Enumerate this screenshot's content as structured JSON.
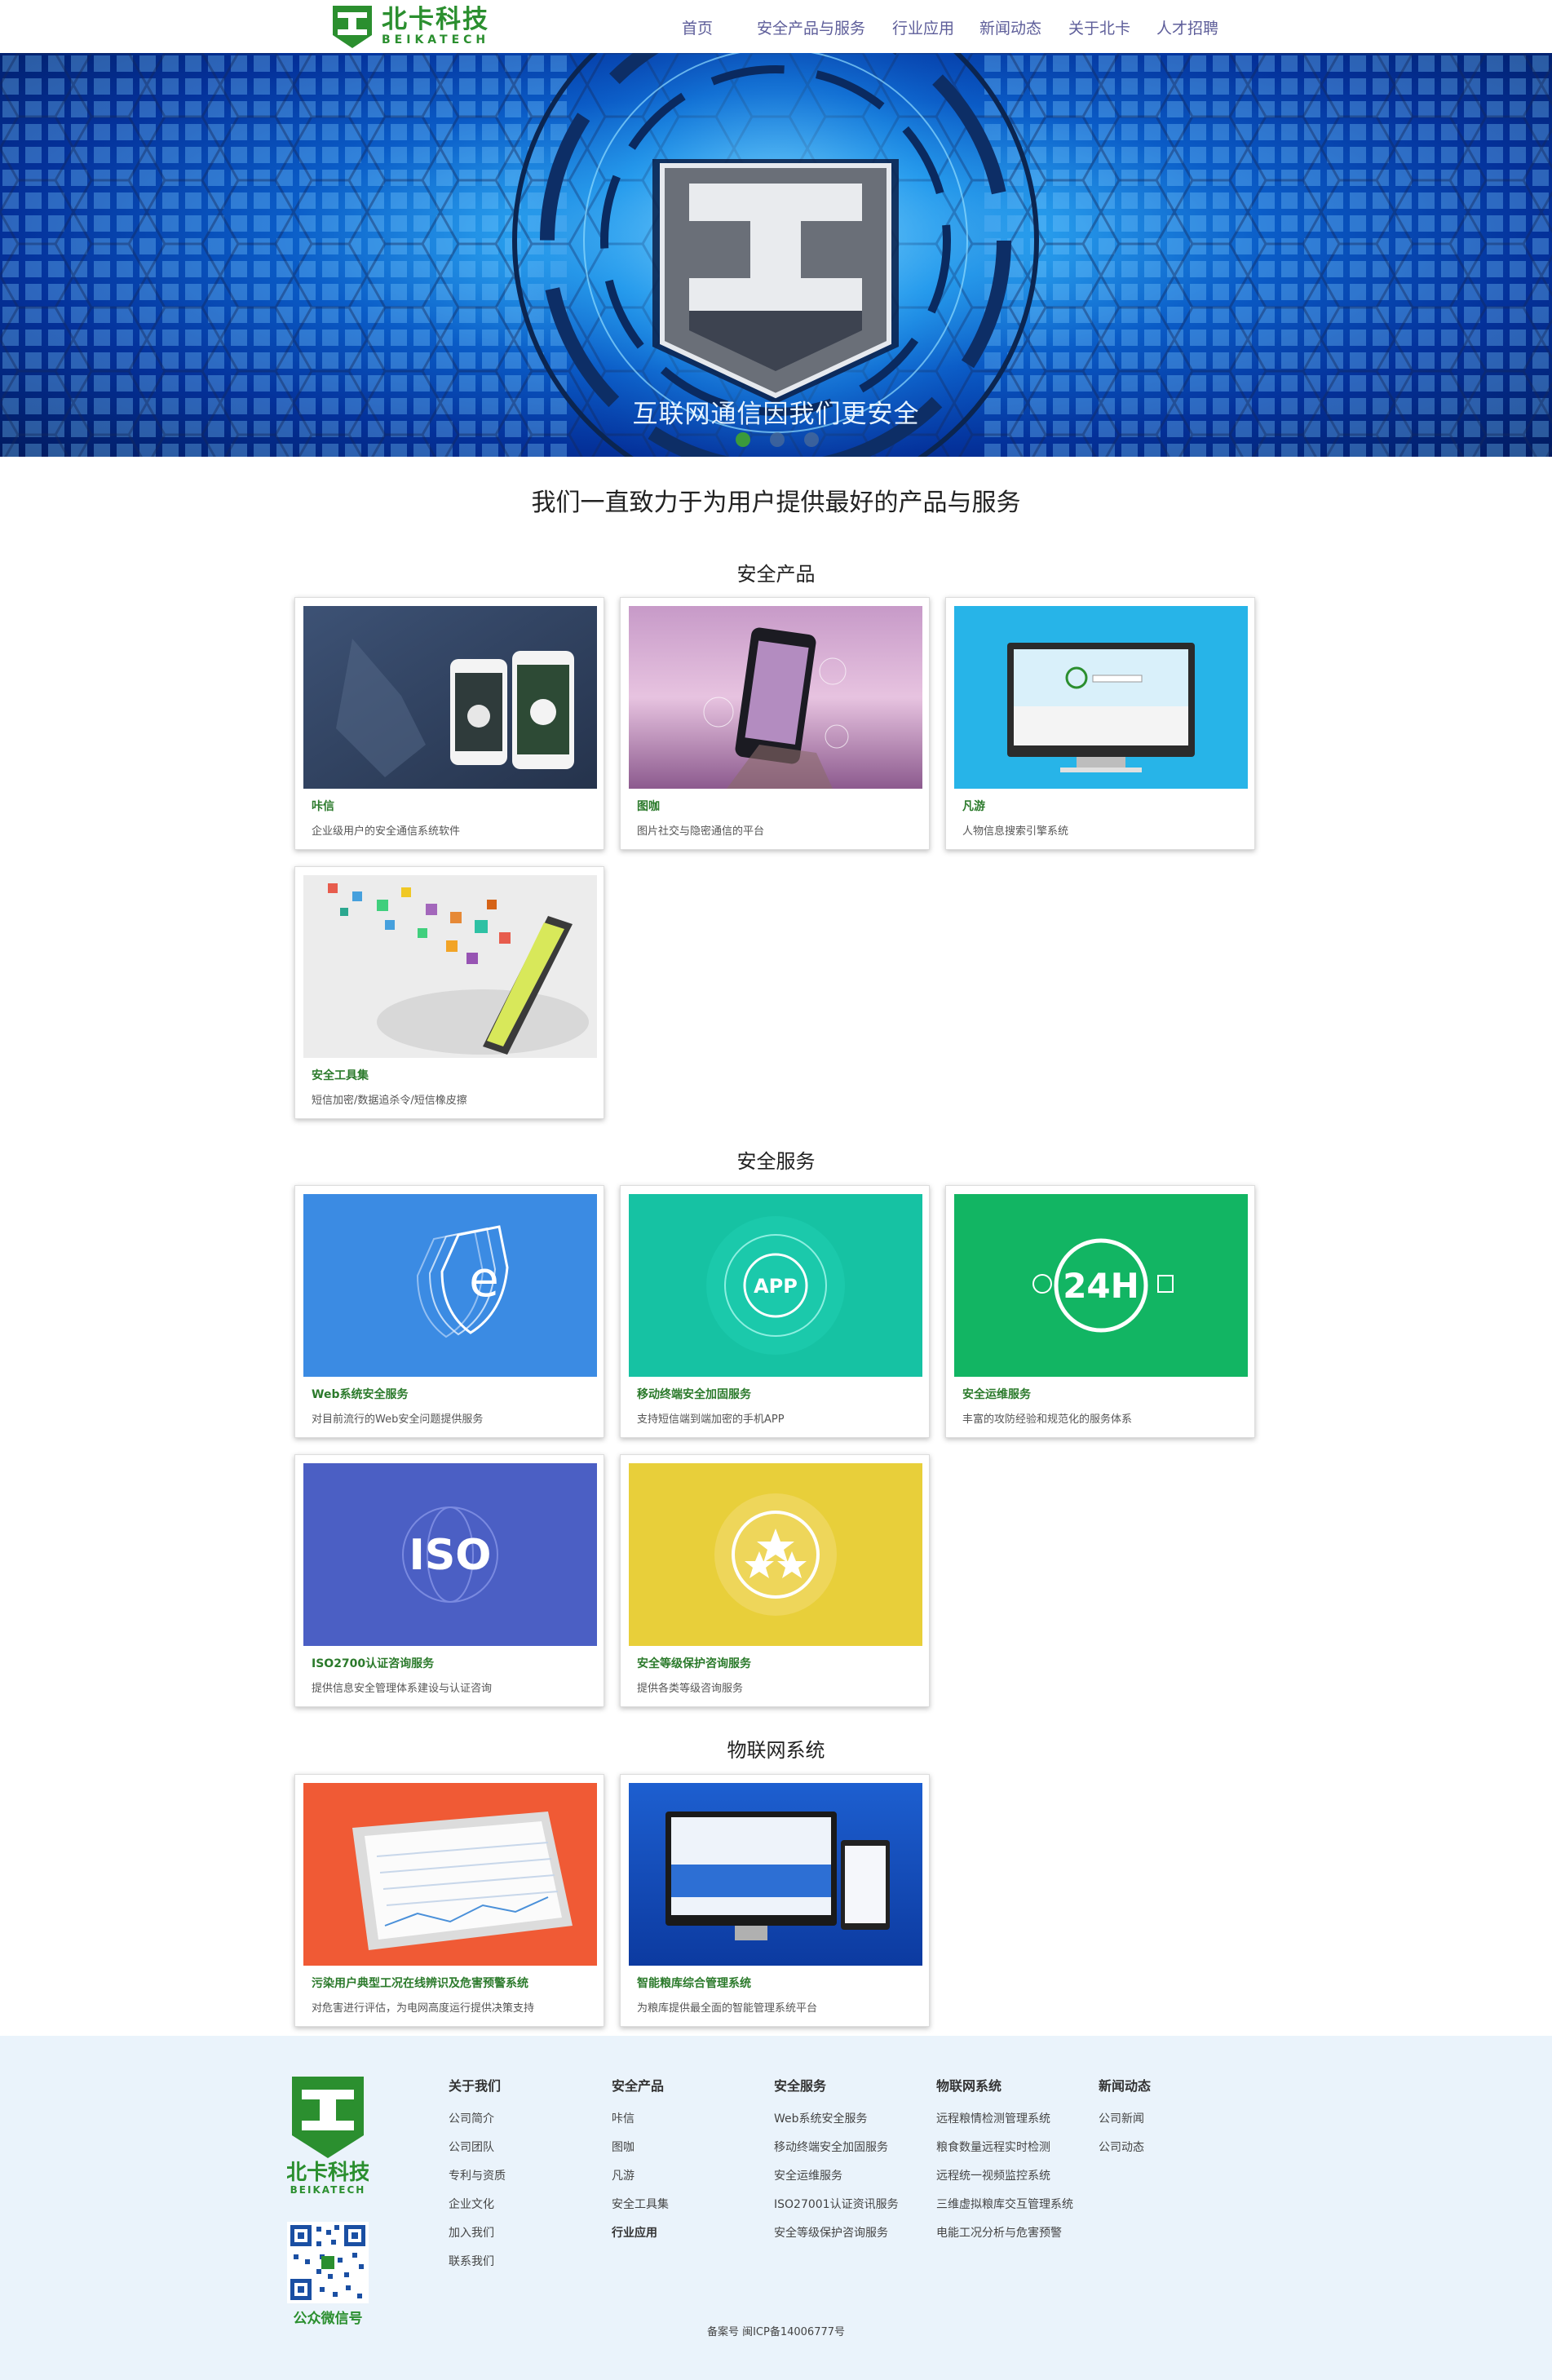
{
  "header": {
    "logo_cn": "北卡科技",
    "logo_en": "BEIKATECH",
    "nav": [
      "首页",
      "安全产品与服务",
      "行业应用",
      "新闻动态",
      "关于北卡",
      "人才招聘"
    ]
  },
  "hero": {
    "caption": "互联网通信因我们更安全",
    "slides": 3,
    "active_slide": 1
  },
  "tagline": "我们一直致力于为用户提供最好的产品与服务",
  "sections": {
    "products": {
      "title": "安全产品",
      "items": [
        {
          "title": "咔信",
          "desc": "企业级用户的安全通信系统软件"
        },
        {
          "title": "图咖",
          "desc": "图片社交与隐密通信的平台"
        },
        {
          "title": "凡游",
          "desc": "人物信息搜索引擎系统"
        },
        {
          "title": "安全工具集",
          "desc": "短信加密/数据追杀令/短信橡皮擦"
        }
      ]
    },
    "services": {
      "title": "安全服务",
      "items": [
        {
          "title": "Web系统安全服务",
          "desc": "对目前流行的Web安全问题提供服务"
        },
        {
          "title": "移动终端安全加固服务",
          "desc": "支持短信端到端加密的手机APP"
        },
        {
          "title": "安全运维服务",
          "desc": "丰富的攻防经验和规范化的服务体系"
        },
        {
          "title": "ISO2700认证咨询服务",
          "desc": "提供信息安全管理体系建设与认证咨询"
        },
        {
          "title": "安全等级保护咨询服务",
          "desc": "提供各类等级咨询服务"
        }
      ]
    },
    "iot": {
      "title": "物联网系统",
      "items": [
        {
          "title": "污染用户典型工况在线辨识及危害预警系统",
          "desc": "对危害进行评估，为电网高度运行提供决策支持"
        },
        {
          "title": "智能粮库综合管理系统",
          "desc": "为粮库提供最全面的智能管理系统平台"
        }
      ]
    }
  },
  "card_images": {
    "app_label": "APP",
    "h24_label": "24H",
    "iso_label": "ISO"
  },
  "footer": {
    "qr_label": "公众微信号",
    "columns": [
      {
        "title": "关于我们",
        "links": [
          "公司简介",
          "公司团队",
          "专利与资质",
          "企业文化",
          "加入我们",
          "联系我们"
        ]
      },
      {
        "title": "安全产品",
        "links": [
          "咔信",
          "图咖",
          "凡游",
          "安全工具集"
        ],
        "extra_bold": "行业应用"
      },
      {
        "title": "安全服务",
        "links": [
          "Web系统安全服务",
          "移动终端安全加固服务",
          "安全运维服务",
          "ISO27001认证资讯服务",
          "安全等级保护咨询服务"
        ]
      },
      {
        "title": "物联网系统",
        "links": [
          "远程粮情检测管理系统",
          "粮食数量远程实时检测",
          "远程统一视频监控系统",
          "三维虚拟粮库交互管理系统",
          "电能工况分析与危害预警"
        ]
      },
      {
        "title": "新闻动态",
        "links": [
          "公司新闻",
          "公司动态"
        ]
      }
    ],
    "icp": "备案号  闽ICP备14006777号"
  },
  "colors": {
    "brand_green": "#2b8f2f",
    "nav_text": "#5e5e9a",
    "footer_bg": "#eaf3fb"
  }
}
